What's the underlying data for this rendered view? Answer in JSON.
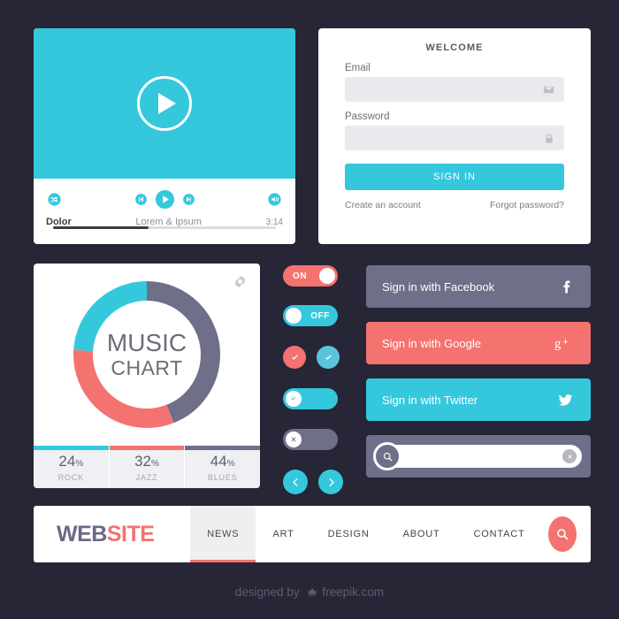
{
  "theme": {
    "background": "#262636",
    "teal": "#35c8dd",
    "coral": "#f4726f",
    "purple": "#6f6f8a",
    "white": "#ffffff",
    "field_gray": "#e9eaee"
  },
  "video_player": {
    "play_icon": "play-icon",
    "controls": {
      "shuffle_icon": "shuffle-icon",
      "previous_icon": "previous-track-icon",
      "play_icon": "play-icon",
      "next_icon": "next-track-icon",
      "volume_icon": "volume-icon"
    },
    "track_title": "Dolor",
    "track_subtitle": "Lorem & Ipsum",
    "duration": "3:14",
    "progress_percent": 43
  },
  "login": {
    "title": "WELCOME",
    "email_label": "Email",
    "email_value": "",
    "email_placeholder": "",
    "email_icon": "envelope-icon",
    "password_label": "Password",
    "password_value": "",
    "password_placeholder": "",
    "password_icon": "lock-icon",
    "submit_label": "SIGN IN",
    "create_account_label": "Create an account",
    "forgot_password_label": "Forgot password?"
  },
  "chart_data": {
    "type": "pie",
    "title": "MUSIC CHART",
    "title_line1": "MUSIC",
    "title_line2": "CHART",
    "categories": [
      "ROCK",
      "JAZZ",
      "BLUES"
    ],
    "values": [
      24,
      32,
      44
    ],
    "value_suffix": "%",
    "colors": [
      "#35c8dd",
      "#f4726f",
      "#6f6f8a"
    ],
    "donut": true,
    "start_angle_deg": 0,
    "direction": "clockwise",
    "slice_order_from_top": [
      "BLUES",
      "JAZZ",
      "ROCK"
    ],
    "legend_position": "bottom",
    "settings_icon": "gear-icon"
  },
  "toggles": {
    "on_toggle": {
      "label": "ON",
      "state": "on",
      "color": "#f4726f",
      "knob_position": "right"
    },
    "off_toggle": {
      "label": "OFF",
      "state": "off",
      "color": "#35c8dd",
      "knob_position": "left"
    },
    "check_coral": {
      "icon": "check-icon",
      "color": "#f4726f"
    },
    "check_teal": {
      "icon": "check-icon",
      "color": "#5bc4dd"
    },
    "check_pill": {
      "icon": "check-icon",
      "color": "#35c8dd",
      "knob_position": "left"
    },
    "cross_pill": {
      "icon": "close-icon",
      "color": "#6f6f8a",
      "knob_position": "left"
    },
    "prev_filled": {
      "icon": "chevron-left-icon",
      "color": "#35c8dd"
    },
    "next_filled": {
      "icon": "chevron-right-icon",
      "color": "#35c8dd"
    },
    "prev_outline": {
      "icon": "chevron-left-icon"
    },
    "next_outline": {
      "icon": "chevron-right-icon"
    }
  },
  "social_buttons": [
    {
      "label": "Sign in with Facebook",
      "icon": "facebook-icon",
      "color": "#6f6f8a"
    },
    {
      "label": "Sign in with Google",
      "icon": "google-plus-icon",
      "color": "#f4726f"
    },
    {
      "label": "Sign in with Twitter",
      "icon": "twitter-icon",
      "color": "#35c8dd"
    }
  ],
  "search_widget": {
    "value": "",
    "placeholder": "",
    "search_icon": "search-icon",
    "clear_icon": "close-icon"
  },
  "navbar": {
    "brand_part1": "WEB",
    "brand_part2": "SITE",
    "items": [
      {
        "label": "NEWS",
        "active": true
      },
      {
        "label": "ART",
        "active": false
      },
      {
        "label": "DESIGN",
        "active": false
      },
      {
        "label": "ABOUT",
        "active": false
      },
      {
        "label": "CONTACT",
        "active": false
      }
    ],
    "search_icon": "search-icon"
  },
  "footer": {
    "prefix": "designed by",
    "brand": "freepik.com",
    "icon": "freepik-crown-icon"
  }
}
